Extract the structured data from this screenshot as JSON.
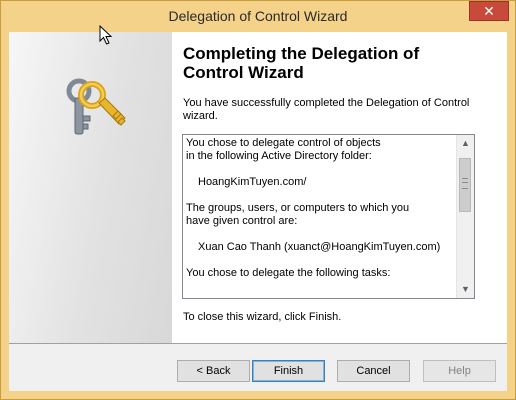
{
  "window": {
    "title": "Delegation of Control Wizard",
    "close_glyph": "✕"
  },
  "heading": "Completing the Delegation of Control Wizard",
  "intro": "You have successfully completed the Delegation of Control wizard.",
  "summary": {
    "folder_intro_line1": "You chose to delegate control of objects",
    "folder_intro_line2": "in the following Active Directory folder:",
    "folder": "HoangKimTuyen.com/",
    "principals_intro_line1": "The groups, users, or computers to which you",
    "principals_intro_line2": "have given control are:",
    "principal": "Xuan Cao Thanh (xuanct@HoangKimTuyen.com)",
    "tasks_intro": "You chose to delegate the following tasks:"
  },
  "scrollbar": {
    "up_glyph": "▲",
    "down_glyph": "▼"
  },
  "closing": "To close this wizard, click Finish.",
  "buttons": {
    "back": "< Back",
    "finish": "Finish",
    "cancel": "Cancel",
    "help": "Help"
  },
  "colors": {
    "title_bar": "#f5d28a",
    "close_button": "#c74a3b",
    "button_bar": "#f0f0f0"
  },
  "icons": {
    "wizard_image": "keys-icon",
    "cursor": "mouse-pointer-icon"
  }
}
